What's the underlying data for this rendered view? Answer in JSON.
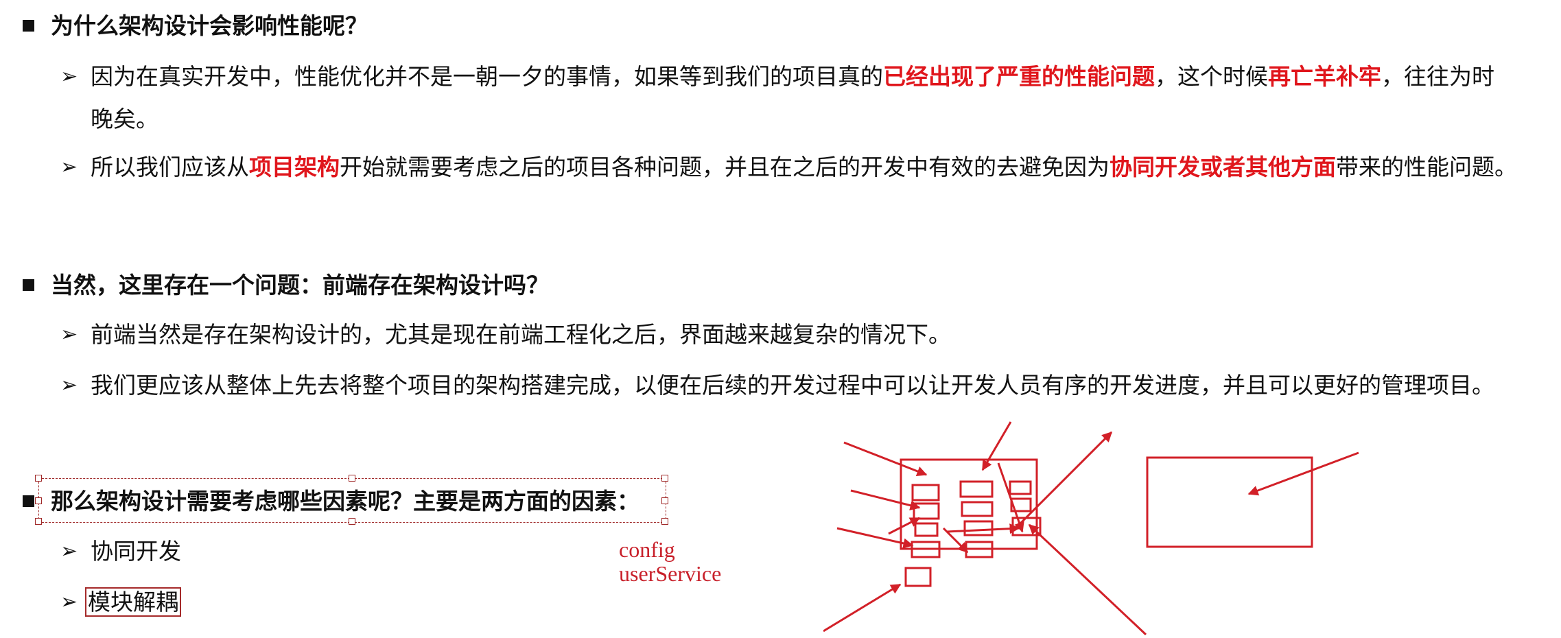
{
  "section1": {
    "heading": "为什么架构设计会影响性能呢？",
    "bullet1": {
      "p1": "因为在真实开发中，性能优化并不是一朝一夕的事情，如果等到我们的项目真的",
      "r1": "已经出现了严重的性能问题",
      "p2": "，这个时候",
      "r2": "再亡羊补牢",
      "p3": "，往往为时",
      "line2": "晚矣。"
    },
    "bullet2": {
      "p1": "所以我们应该从",
      "r1": "项目架构",
      "p2": "开始就需要考虑之后的项目各种问题，并且在之后的开发中有效的去避免因为",
      "r2": "协同开发或者其他方面",
      "p3": "带来的性能问题。"
    }
  },
  "section2": {
    "heading": "当然，这里存在一个问题：前端存在架构设计吗？",
    "bullet1": "前端当然是存在架构设计的，尤其是现在前端工程化之后，界面越来越复杂的情况下。",
    "bullet2": "我们更应该从整体上先去将整个项目的架构搭建完成，以便在后续的开发过程中可以让开发人员有序的开发进度，并且可以更好的管理项目。"
  },
  "section3": {
    "heading": "那么架构设计需要考虑哪些因素呢？主要是两方面的因素：",
    "bullet1": "协同开发",
    "bullet2": "模块解耦"
  },
  "annotation": {
    "line1": "config",
    "line2": "userService"
  },
  "colors": {
    "accent_red": "#e0161c",
    "sketch_red": "#c8202a",
    "text": "#111111"
  }
}
